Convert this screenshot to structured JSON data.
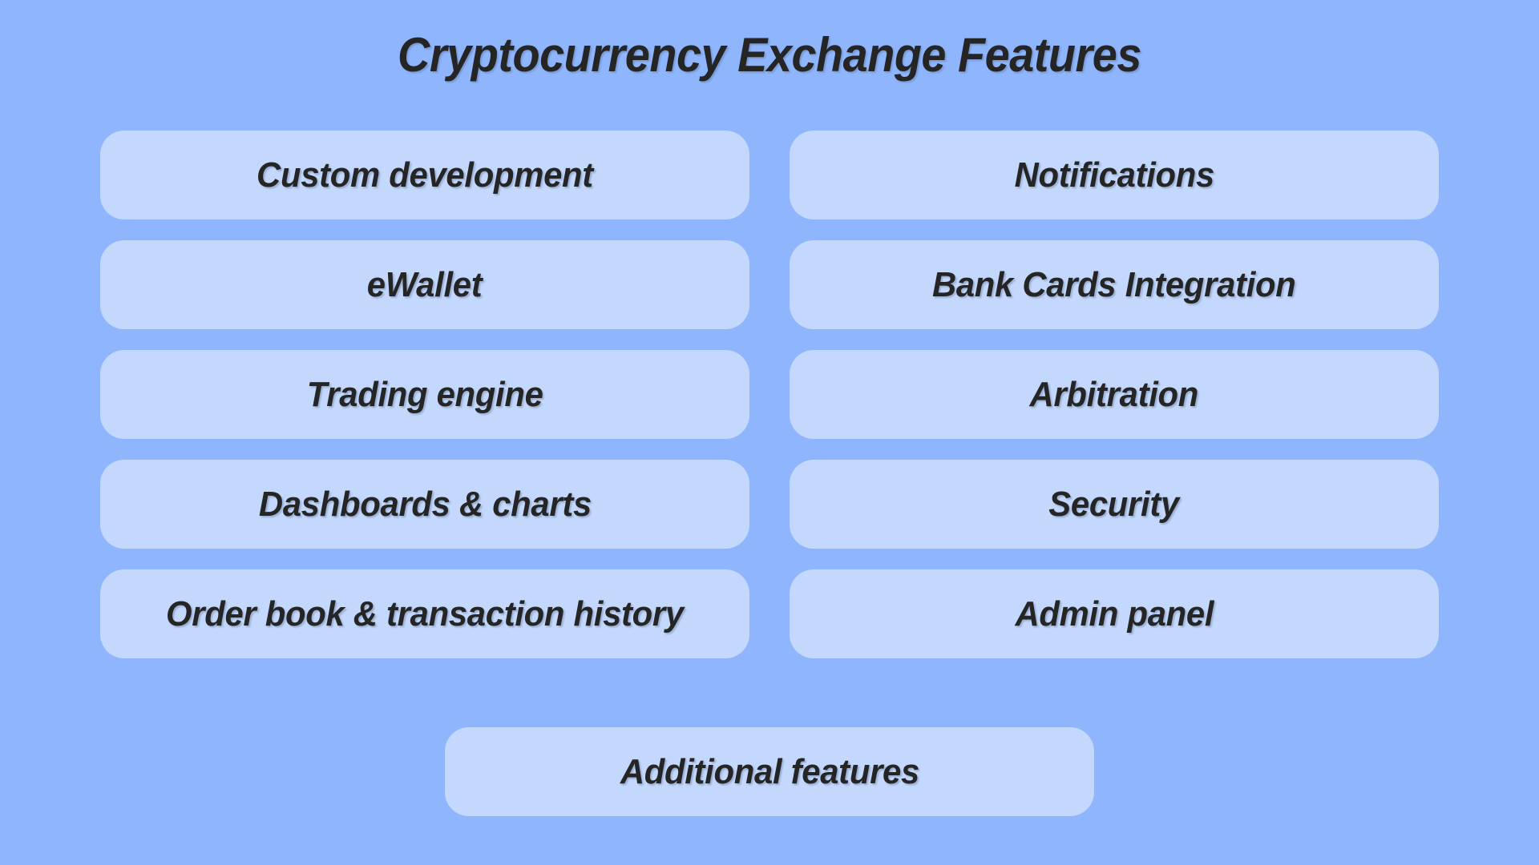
{
  "title": "Cryptocurrency Exchange Features",
  "colors": {
    "background": "#8fb6fd",
    "card": "#c3d8fc",
    "text": "#252525"
  },
  "features": {
    "left_column": [
      {
        "label": "Custom development"
      },
      {
        "label": "eWallet"
      },
      {
        "label": "Trading engine"
      },
      {
        "label": "Dashboards & charts"
      },
      {
        "label": "Order book & transaction history"
      }
    ],
    "right_column": [
      {
        "label": "Notifications"
      },
      {
        "label": "Bank Cards Integration"
      },
      {
        "label": "Arbitration"
      },
      {
        "label": "Security"
      },
      {
        "label": "Admin panel"
      }
    ],
    "footer": {
      "label": "Additional features"
    }
  }
}
